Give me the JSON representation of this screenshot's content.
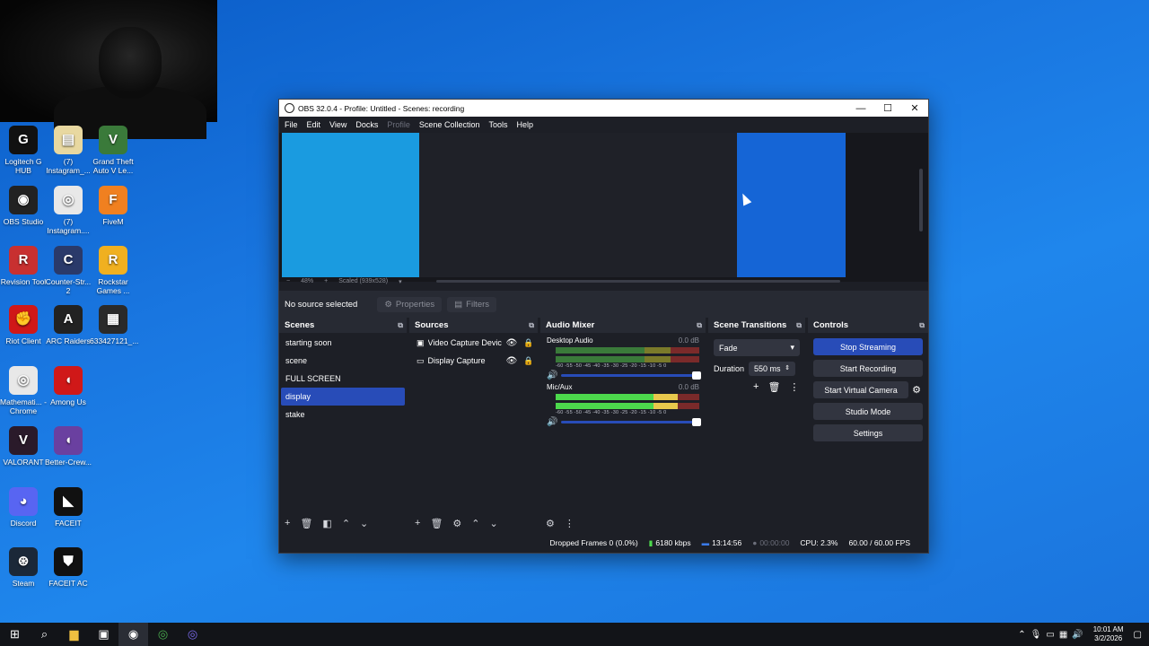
{
  "desktop": {
    "icons": [
      {
        "label": "Logitech G HUB",
        "glyph": "G",
        "color": "#111111",
        "icon": "logitech-icon"
      },
      {
        "label": "(7) Instagram_...",
        "glyph": "▤",
        "color": "#e8d8a0",
        "icon": "file-icon"
      },
      {
        "label": "Grand Theft Auto V Le...",
        "glyph": "V",
        "color": "#3a7a3a",
        "icon": "gta-icon"
      },
      {
        "label": "OBS Studio",
        "glyph": "◉",
        "color": "#222222",
        "icon": "obs-icon"
      },
      {
        "label": "(7) Instagram....",
        "glyph": "◎",
        "color": "#e8e8e8",
        "icon": "chrome-icon"
      },
      {
        "label": "FiveM",
        "glyph": "F",
        "color": "#f08020",
        "icon": "fivem-icon"
      },
      {
        "label": "Revision Tool",
        "glyph": "R",
        "color": "#c83030",
        "icon": "revision-icon"
      },
      {
        "label": "Counter-Str... 2",
        "glyph": "C",
        "color": "#2a3a6a",
        "icon": "counter-strike-icon"
      },
      {
        "label": "Rockstar Games ...",
        "glyph": "R",
        "color": "#f0b020",
        "icon": "rockstar-icon"
      },
      {
        "label": "Riot Client",
        "glyph": "✊",
        "color": "#d01818",
        "icon": "riot-icon"
      },
      {
        "label": "ARC Raiders",
        "glyph": "A",
        "color": "#222222",
        "icon": "arc-raiders-icon"
      },
      {
        "label": "633427121_...",
        "glyph": "▦",
        "color": "#2a2a2a",
        "icon": "image-file-icon"
      },
      {
        "label": "Mathemati... - Chrome",
        "glyph": "◎",
        "color": "#e8e8e8",
        "icon": "chrome-icon"
      },
      {
        "label": "Among Us",
        "glyph": "◖",
        "color": "#d01818",
        "icon": "among-us-icon"
      },
      {
        "label": "VALORANT",
        "glyph": "V",
        "color": "#2a1a2a",
        "icon": "valorant-icon"
      },
      {
        "label": "Better-Crew...",
        "glyph": "◖",
        "color": "#6a40a0",
        "icon": "better-crewlink-icon"
      },
      {
        "label": "Discord",
        "glyph": "◕",
        "color": "#5865f2",
        "icon": "discord-icon"
      },
      {
        "label": "FACEIT",
        "glyph": "◣",
        "color": "#111111",
        "icon": "faceit-icon"
      },
      {
        "label": "Steam",
        "glyph": "⊛",
        "color": "#1b2838",
        "icon": "steam-icon"
      },
      {
        "label": "FACEIT AC",
        "glyph": "⛊",
        "color": "#111111",
        "icon": "faceit-ac-icon"
      }
    ]
  },
  "obs": {
    "title": "OBS 32.0.4 - Profile: Untitled - Scenes: recording",
    "menu": [
      "File",
      "Edit",
      "View",
      "Docks",
      "Profile",
      "Scene Collection",
      "Tools",
      "Help"
    ],
    "zoom": "48%",
    "scaled": "Scaled (939x528)",
    "no_source": "No source selected",
    "properties": "Properties",
    "filters": "Filters",
    "scenes": {
      "title": "Scenes",
      "items": [
        "starting soon",
        "scene",
        "FULL SCREEN",
        "display",
        "stake"
      ],
      "selected": "display"
    },
    "sources": {
      "title": "Sources",
      "items": [
        {
          "name": "Video Capture Devic",
          "type": "camera-icon"
        },
        {
          "name": "Display Capture",
          "type": "monitor-icon"
        }
      ]
    },
    "mixer": {
      "title": "Audio Mixer",
      "channels": [
        {
          "name": "Desktop Audio",
          "db": "0.0 dB",
          "level": 0.0
        },
        {
          "name": "Mic/Aux",
          "db": "0.0 dB",
          "level": 0.85
        }
      ],
      "ticks": "-60 -55 -50 -45 -40 -35 -30 -25 -20 -15 -10 -5 0"
    },
    "transitions": {
      "title": "Scene Transitions",
      "selected": "Fade",
      "duration_label": "Duration",
      "duration": "550 ms"
    },
    "controls": {
      "title": "Controls",
      "stop_streaming": "Stop Streaming",
      "start_recording": "Start Recording",
      "start_virtual_camera": "Start Virtual Camera",
      "studio_mode": "Studio Mode",
      "settings": "Settings"
    },
    "status": {
      "dropped": "Dropped Frames 0 (0.0%)",
      "bitrate": "6180 kbps",
      "stream_time": "13:14:56",
      "rec_time": "00:00:00",
      "cpu": "CPU: 2.3%",
      "fps": "60.00 / 60.00 FPS"
    }
  },
  "taskbar": {
    "time": "10:01 AM",
    "date": "3/2/2026"
  }
}
